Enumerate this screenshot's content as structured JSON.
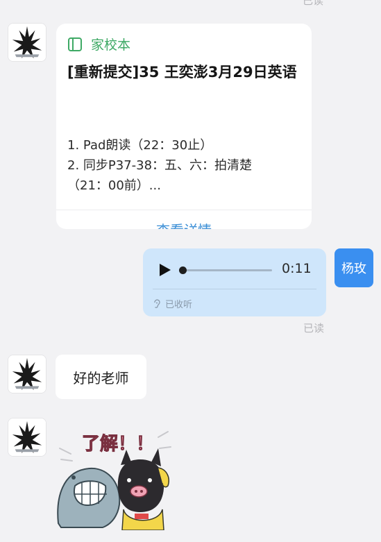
{
  "chat": {
    "top_read_label": "已读",
    "homework_card": {
      "app_name": "家校本",
      "title": "[重新提交]35 王奕澎3月29日英语",
      "lines": [
        "1. Pad朗读（22：30止）",
        "2. 同步P37-38：五、六：拍清楚",
        "（21：00前）..."
      ],
      "link_label": "查看详情"
    },
    "voice_message": {
      "duration": "0:11",
      "progress": 0,
      "status": "已收听"
    },
    "sender_name": "杨玫",
    "read_label": "已读",
    "reply_text": "好的老师",
    "sticker_text": "了解！！"
  },
  "colors": {
    "background": "#f2f2f4",
    "card_app_green": "#3ea965",
    "link_blue": "#3c8fd6",
    "voice_bubble": "#cfe6fb",
    "sender_badge": "#3a8ff0"
  },
  "icons": {
    "card_app": "notebook-icon",
    "play": "play-icon",
    "status": "ear-icon"
  }
}
